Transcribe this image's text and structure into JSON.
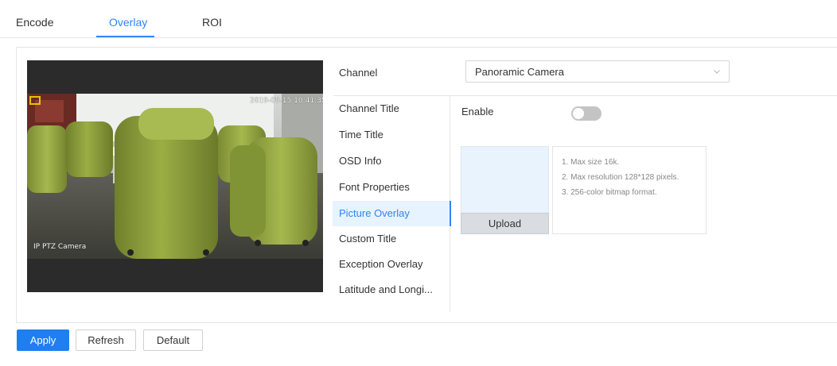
{
  "tabs": [
    {
      "label": "Encode",
      "active": false
    },
    {
      "label": "Overlay",
      "active": true
    },
    {
      "label": "ROI",
      "active": false
    }
  ],
  "preview": {
    "osd_timestamp": "2019-05-15 10:41:35",
    "osd_channel_name": "IP PTZ Camera",
    "osd_box_color": "#e8c200"
  },
  "channel": {
    "label": "Channel",
    "selected": "Panoramic Camera"
  },
  "menu": {
    "items": [
      {
        "label": "Channel Title",
        "active": false
      },
      {
        "label": "Time Title",
        "active": false
      },
      {
        "label": "OSD Info",
        "active": false
      },
      {
        "label": "Font Properties",
        "active": false
      },
      {
        "label": "Picture Overlay",
        "active": true
      },
      {
        "label": "Custom Title",
        "active": false
      },
      {
        "label": "Exception Overlay",
        "active": false
      },
      {
        "label": "Latitude and Longi...",
        "active": false
      }
    ]
  },
  "picture_overlay": {
    "enable_label": "Enable",
    "enabled": false,
    "upload_label": "Upload",
    "hints": [
      "1. Max size 16k.",
      "2. Max resolution 128*128 pixels.",
      "3. 256-color bitmap format."
    ]
  },
  "actions": {
    "apply": "Apply",
    "refresh": "Refresh",
    "default": "Default"
  },
  "colors": {
    "accent": "#2f86f6",
    "primary_button": "#1f7ef0",
    "active_menu_bg": "#e7f3fe",
    "toggle_off": "#c4c4c4"
  }
}
